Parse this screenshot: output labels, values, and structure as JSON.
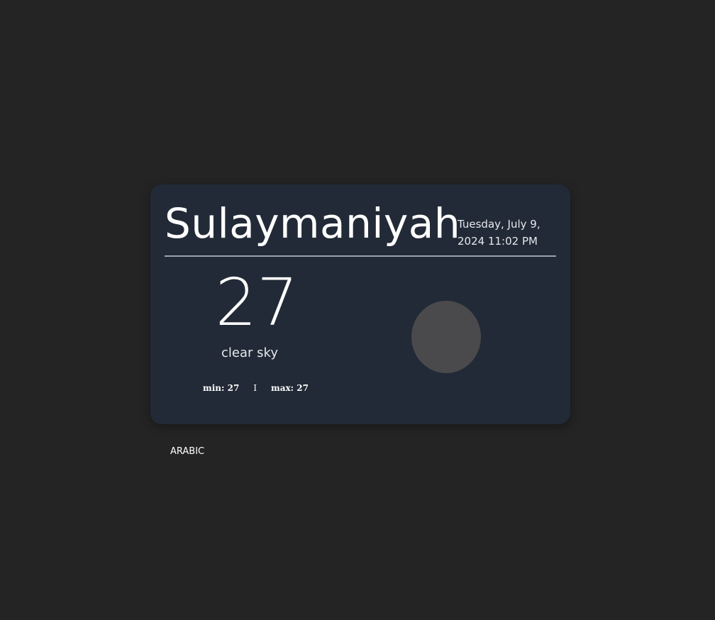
{
  "weather": {
    "city": "Sulaymaniyah",
    "datetime": "Tuesday, July 9, 2024 11:02 PM",
    "temperature": "27",
    "description": "clear sky",
    "min_label": "min: 27",
    "separator": "I",
    "max_label": "max: 27",
    "icon": "weather-icon"
  },
  "language_toggle": {
    "label": "ARABIC"
  }
}
